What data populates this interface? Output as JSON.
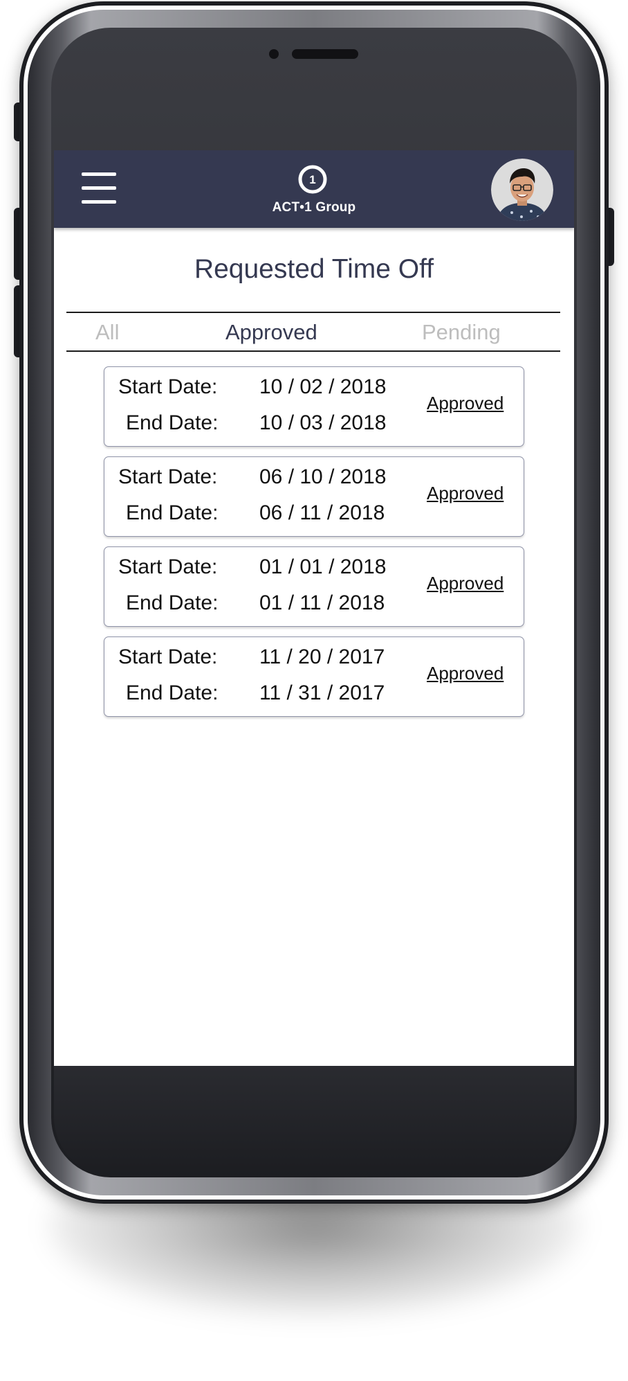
{
  "app": {
    "logo_text": "ACT•1 Group",
    "logo_number": "1"
  },
  "page": {
    "title": "Requested Time Off"
  },
  "tabs": [
    {
      "label": "All",
      "active": false
    },
    {
      "label": "Approved",
      "active": true
    },
    {
      "label": "Pending",
      "active": false
    }
  ],
  "labels": {
    "start": "Start Date:",
    "end": "End Date:"
  },
  "requests": [
    {
      "start": "10 / 02 / 2018",
      "end": "10 / 03 / 2018",
      "status": "Approved"
    },
    {
      "start": "06 / 10 / 2018",
      "end": "06 / 11 / 2018",
      "status": "Approved"
    },
    {
      "start": "01 / 01 / 2018",
      "end": "01 / 11 / 2018",
      "status": "Approved"
    },
    {
      "start": "11 / 20 / 2017",
      "end": "11 / 31 / 2017",
      "status": "Approved"
    }
  ],
  "colors": {
    "header": "#353951",
    "title": "#353951",
    "tab_active": "#353951",
    "tab_inactive": "#bdbdbd",
    "card_border": "#8f93a8"
  },
  "icons": {
    "menu": "hamburger-menu-icon",
    "logo": "act1-logo-icon",
    "avatar": "user-avatar"
  }
}
